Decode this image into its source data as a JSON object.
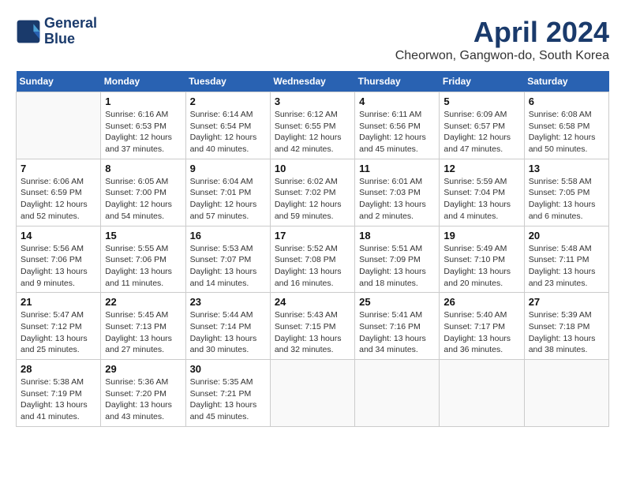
{
  "header": {
    "logo_line1": "General",
    "logo_line2": "Blue",
    "title": "April 2024",
    "subtitle": "Cheorwon, Gangwon-do, South Korea"
  },
  "weekdays": [
    "Sunday",
    "Monday",
    "Tuesday",
    "Wednesday",
    "Thursday",
    "Friday",
    "Saturday"
  ],
  "weeks": [
    [
      {
        "day": "",
        "sunrise": "",
        "sunset": "",
        "daylight": ""
      },
      {
        "day": "1",
        "sunrise": "Sunrise: 6:16 AM",
        "sunset": "Sunset: 6:53 PM",
        "daylight": "Daylight: 12 hours and 37 minutes."
      },
      {
        "day": "2",
        "sunrise": "Sunrise: 6:14 AM",
        "sunset": "Sunset: 6:54 PM",
        "daylight": "Daylight: 12 hours and 40 minutes."
      },
      {
        "day": "3",
        "sunrise": "Sunrise: 6:12 AM",
        "sunset": "Sunset: 6:55 PM",
        "daylight": "Daylight: 12 hours and 42 minutes."
      },
      {
        "day": "4",
        "sunrise": "Sunrise: 6:11 AM",
        "sunset": "Sunset: 6:56 PM",
        "daylight": "Daylight: 12 hours and 45 minutes."
      },
      {
        "day": "5",
        "sunrise": "Sunrise: 6:09 AM",
        "sunset": "Sunset: 6:57 PM",
        "daylight": "Daylight: 12 hours and 47 minutes."
      },
      {
        "day": "6",
        "sunrise": "Sunrise: 6:08 AM",
        "sunset": "Sunset: 6:58 PM",
        "daylight": "Daylight: 12 hours and 50 minutes."
      }
    ],
    [
      {
        "day": "7",
        "sunrise": "Sunrise: 6:06 AM",
        "sunset": "Sunset: 6:59 PM",
        "daylight": "Daylight: 12 hours and 52 minutes."
      },
      {
        "day": "8",
        "sunrise": "Sunrise: 6:05 AM",
        "sunset": "Sunset: 7:00 PM",
        "daylight": "Daylight: 12 hours and 54 minutes."
      },
      {
        "day": "9",
        "sunrise": "Sunrise: 6:04 AM",
        "sunset": "Sunset: 7:01 PM",
        "daylight": "Daylight: 12 hours and 57 minutes."
      },
      {
        "day": "10",
        "sunrise": "Sunrise: 6:02 AM",
        "sunset": "Sunset: 7:02 PM",
        "daylight": "Daylight: 12 hours and 59 minutes."
      },
      {
        "day": "11",
        "sunrise": "Sunrise: 6:01 AM",
        "sunset": "Sunset: 7:03 PM",
        "daylight": "Daylight: 13 hours and 2 minutes."
      },
      {
        "day": "12",
        "sunrise": "Sunrise: 5:59 AM",
        "sunset": "Sunset: 7:04 PM",
        "daylight": "Daylight: 13 hours and 4 minutes."
      },
      {
        "day": "13",
        "sunrise": "Sunrise: 5:58 AM",
        "sunset": "Sunset: 7:05 PM",
        "daylight": "Daylight: 13 hours and 6 minutes."
      }
    ],
    [
      {
        "day": "14",
        "sunrise": "Sunrise: 5:56 AM",
        "sunset": "Sunset: 7:06 PM",
        "daylight": "Daylight: 13 hours and 9 minutes."
      },
      {
        "day": "15",
        "sunrise": "Sunrise: 5:55 AM",
        "sunset": "Sunset: 7:06 PM",
        "daylight": "Daylight: 13 hours and 11 minutes."
      },
      {
        "day": "16",
        "sunrise": "Sunrise: 5:53 AM",
        "sunset": "Sunset: 7:07 PM",
        "daylight": "Daylight: 13 hours and 14 minutes."
      },
      {
        "day": "17",
        "sunrise": "Sunrise: 5:52 AM",
        "sunset": "Sunset: 7:08 PM",
        "daylight": "Daylight: 13 hours and 16 minutes."
      },
      {
        "day": "18",
        "sunrise": "Sunrise: 5:51 AM",
        "sunset": "Sunset: 7:09 PM",
        "daylight": "Daylight: 13 hours and 18 minutes."
      },
      {
        "day": "19",
        "sunrise": "Sunrise: 5:49 AM",
        "sunset": "Sunset: 7:10 PM",
        "daylight": "Daylight: 13 hours and 20 minutes."
      },
      {
        "day": "20",
        "sunrise": "Sunrise: 5:48 AM",
        "sunset": "Sunset: 7:11 PM",
        "daylight": "Daylight: 13 hours and 23 minutes."
      }
    ],
    [
      {
        "day": "21",
        "sunrise": "Sunrise: 5:47 AM",
        "sunset": "Sunset: 7:12 PM",
        "daylight": "Daylight: 13 hours and 25 minutes."
      },
      {
        "day": "22",
        "sunrise": "Sunrise: 5:45 AM",
        "sunset": "Sunset: 7:13 PM",
        "daylight": "Daylight: 13 hours and 27 minutes."
      },
      {
        "day": "23",
        "sunrise": "Sunrise: 5:44 AM",
        "sunset": "Sunset: 7:14 PM",
        "daylight": "Daylight: 13 hours and 30 minutes."
      },
      {
        "day": "24",
        "sunrise": "Sunrise: 5:43 AM",
        "sunset": "Sunset: 7:15 PM",
        "daylight": "Daylight: 13 hours and 32 minutes."
      },
      {
        "day": "25",
        "sunrise": "Sunrise: 5:41 AM",
        "sunset": "Sunset: 7:16 PM",
        "daylight": "Daylight: 13 hours and 34 minutes."
      },
      {
        "day": "26",
        "sunrise": "Sunrise: 5:40 AM",
        "sunset": "Sunset: 7:17 PM",
        "daylight": "Daylight: 13 hours and 36 minutes."
      },
      {
        "day": "27",
        "sunrise": "Sunrise: 5:39 AM",
        "sunset": "Sunset: 7:18 PM",
        "daylight": "Daylight: 13 hours and 38 minutes."
      }
    ],
    [
      {
        "day": "28",
        "sunrise": "Sunrise: 5:38 AM",
        "sunset": "Sunset: 7:19 PM",
        "daylight": "Daylight: 13 hours and 41 minutes."
      },
      {
        "day": "29",
        "sunrise": "Sunrise: 5:36 AM",
        "sunset": "Sunset: 7:20 PM",
        "daylight": "Daylight: 13 hours and 43 minutes."
      },
      {
        "day": "30",
        "sunrise": "Sunrise: 5:35 AM",
        "sunset": "Sunset: 7:21 PM",
        "daylight": "Daylight: 13 hours and 45 minutes."
      },
      {
        "day": "",
        "sunrise": "",
        "sunset": "",
        "daylight": ""
      },
      {
        "day": "",
        "sunrise": "",
        "sunset": "",
        "daylight": ""
      },
      {
        "day": "",
        "sunrise": "",
        "sunset": "",
        "daylight": ""
      },
      {
        "day": "",
        "sunrise": "",
        "sunset": "",
        "daylight": ""
      }
    ]
  ]
}
